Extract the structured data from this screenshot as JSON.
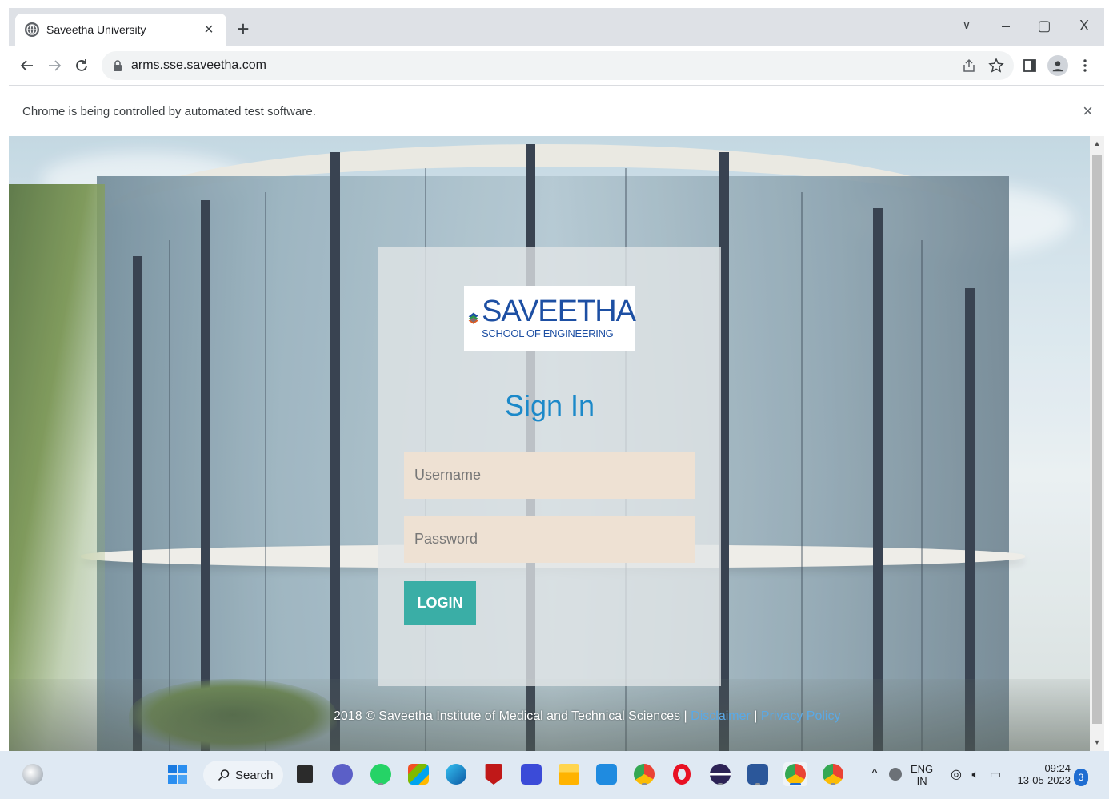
{
  "browser": {
    "tab": {
      "title": "Saveetha University",
      "close": "×"
    },
    "new_tab": "+",
    "window_controls": {
      "dropdown": "∨",
      "minimize": "–",
      "maximize": "▢",
      "close": "X"
    },
    "url": "arms.sse.saveetha.com",
    "infobar": {
      "message": "Chrome is being controlled by automated test software.",
      "close": "×"
    }
  },
  "page": {
    "logo": {
      "name": "SAVEETHA",
      "subtitle": "SCHOOL OF ENGINEERING"
    },
    "heading": "Sign In",
    "username_placeholder": "Username",
    "password_placeholder": "Password",
    "login_label": "LOGIN",
    "footer": {
      "copyright": "2018 © Saveetha Institute of Medical and Technical Sciences |",
      "disclaimer": "Disclaimer",
      "separator": "|",
      "privacy": "Privacy Policy"
    }
  },
  "taskbar": {
    "search_label": "Search",
    "language_top": "ENG",
    "language_bottom": "IN",
    "time": "09:24",
    "date": "13-05-2023",
    "notification_count": "3",
    "apps": [
      "start-icon",
      "file-explorer-icon",
      "teams-icon",
      "whatsapp-icon",
      "store-icon",
      "edge-icon",
      "mcafee-icon",
      "visual-studio-icon",
      "folder-icon",
      "prime-video-icon",
      "chrome-icon",
      "opera-icon",
      "eclipse-icon",
      "word-icon",
      "chrome-icon",
      "chrome-icon"
    ]
  },
  "colors": {
    "accent": "#1c89c9",
    "login_button": "#3aaea6",
    "input_background": "#eee1d3",
    "link": "#5aa9e6"
  }
}
